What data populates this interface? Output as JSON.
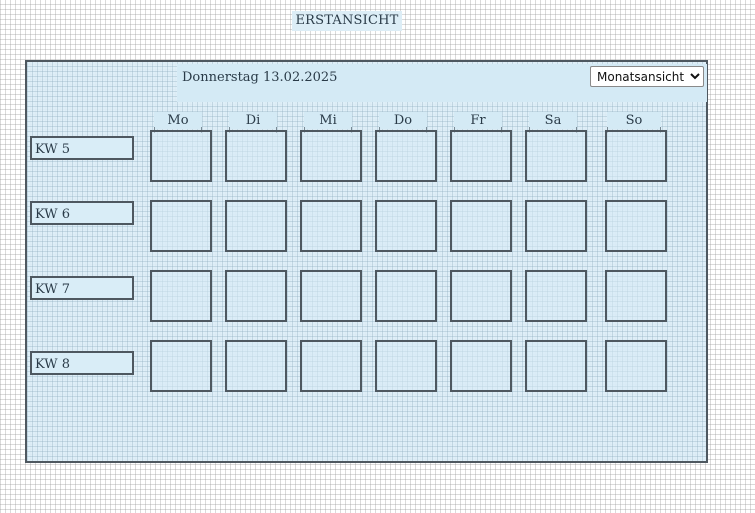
{
  "page": {
    "title": "ERSTANSICHT"
  },
  "calendar": {
    "date_label": "Donnerstag 13.02.2025",
    "view_select": {
      "selected": "Monatsansicht",
      "options": [
        "Monatsansicht"
      ]
    },
    "weekdays": [
      "Mo",
      "Di",
      "Mi",
      "Do",
      "Fr",
      "Sa",
      "So"
    ],
    "weeks": [
      "KW 5",
      "KW 6",
      "KW 7",
      "KW 8"
    ]
  }
}
